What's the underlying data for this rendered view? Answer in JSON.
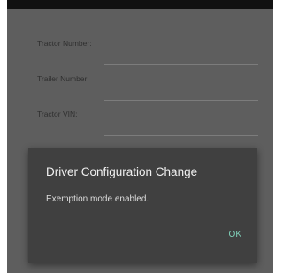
{
  "form": {
    "tractor_number_label": "Tractor Number:",
    "trailer_number_label": "Trailer Number:",
    "tractor_vin_label": "Tractor VIN:"
  },
  "dialog": {
    "title": "Driver Configuration Change",
    "message": "Exemption mode enabled.",
    "ok_label": "OK"
  },
  "colors": {
    "scrim": "#5e5e5e",
    "dialog_background": "#404040",
    "accent": "#7fd0b8"
  }
}
